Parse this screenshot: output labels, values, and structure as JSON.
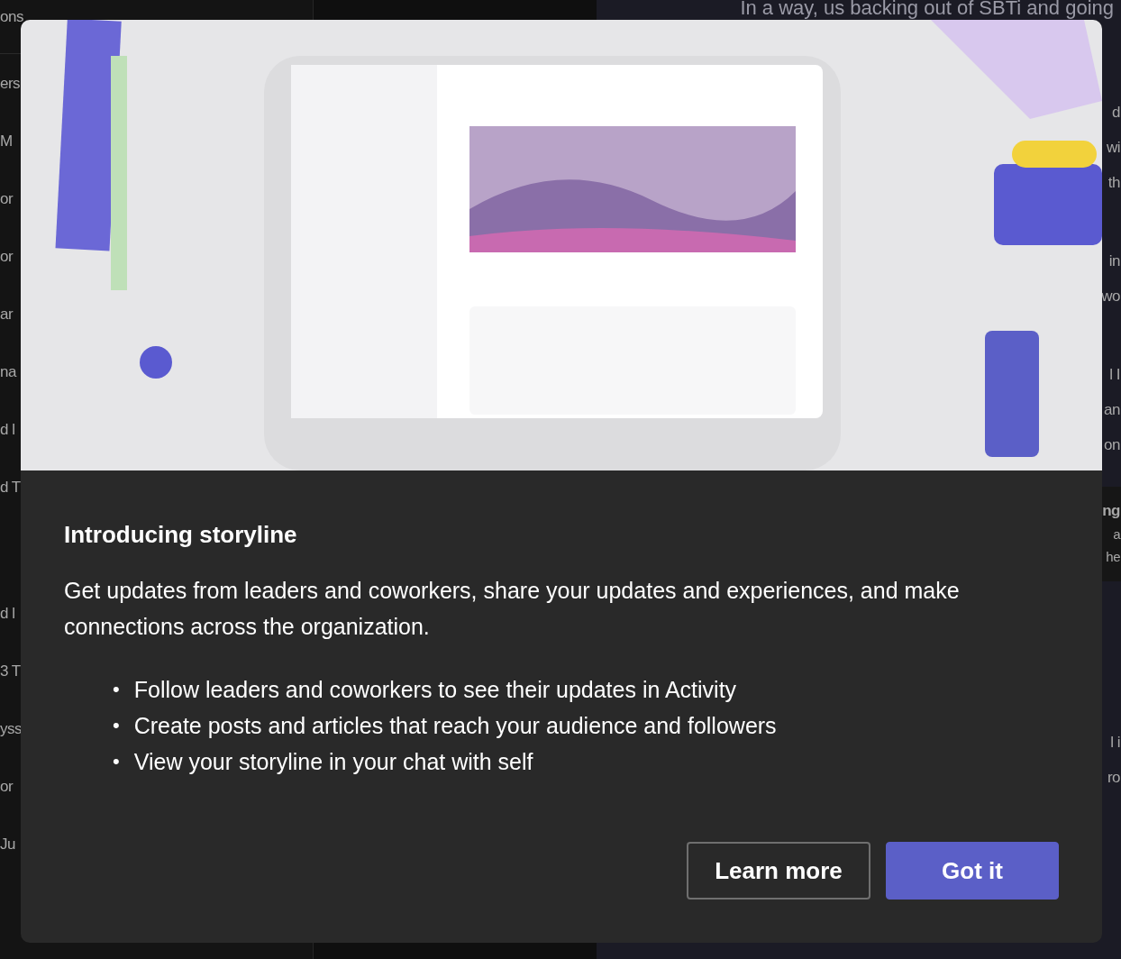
{
  "background": {
    "left_list": {
      "header": "ons",
      "items": [
        {
          "text": "ers"
        },
        {
          "text": "M"
        },
        {
          "text": "or"
        },
        {
          "text": "or"
        },
        {
          "text": "ar"
        },
        {
          "text": "na"
        },
        {
          "text": "d l"
        },
        {
          "text": "d T"
        },
        {
          "text": "d l"
        },
        {
          "text": "3 T"
        },
        {
          "text": "yss"
        },
        {
          "text": "or"
        },
        {
          "text": "Ju"
        }
      ]
    },
    "top_line": "In a way, us backing out of SBTi and going",
    "right_groups": [
      {
        "kind": "body",
        "lines": [
          "d",
          "wi",
          "th"
        ]
      },
      {
        "kind": "body",
        "lines": [
          "in",
          "wo"
        ]
      },
      {
        "kind": "body",
        "lines": [
          "l I",
          "an",
          "on"
        ]
      },
      {
        "kind": "card",
        "lines": [
          "ng",
          "a",
          "he"
        ]
      },
      {
        "kind": "body",
        "lines": [
          "l i",
          "ro"
        ]
      }
    ]
  },
  "dialog": {
    "title": "Introducing storyline",
    "description": "Get updates from leaders and coworkers, share your updates and experiences, and make connections across the organization.",
    "bullets": [
      {
        "marker": "•",
        "text": "Follow leaders and coworkers to see their updates in Activity"
      },
      {
        "marker": "•",
        "text": "Create posts and articles that reach your audience and followers"
      },
      {
        "marker": "•",
        "text": "View your storyline in your chat with self"
      }
    ],
    "buttons": [
      {
        "label": "Learn more",
        "kind": "secondary"
      },
      {
        "label": "Got it",
        "kind": "primary"
      }
    ]
  }
}
